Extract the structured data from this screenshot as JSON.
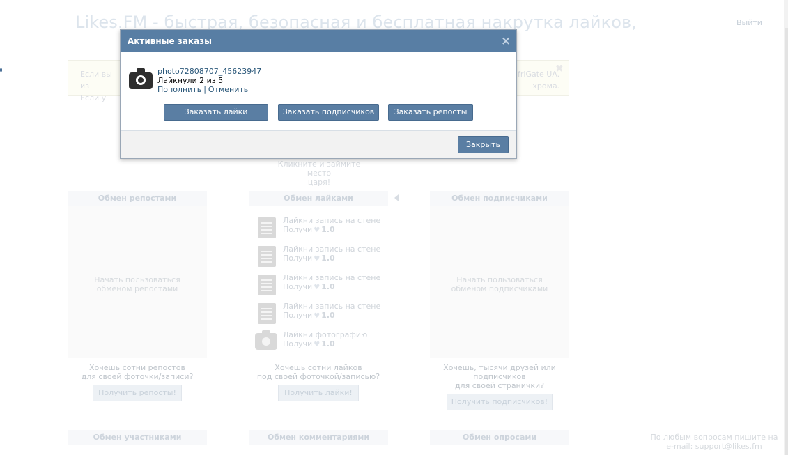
{
  "page": {
    "site_title": "Likes.FM - быстрая, безопасная и бесплатная накрутка лайков,",
    "logout": "Выйти",
    "info_left": "Если вы из\nЕсли у",
    "info_right": "friGate UA.\nхрома.",
    "info_close": "✖",
    "king_text": "Кликните и займите место\nцаря!",
    "footer_note": "По любым вопросам пишите на\ne-mail: support@likes.fm"
  },
  "columns": [
    {
      "title": "Обмен репостами",
      "empty": "Начать пользоваться\nобменом репостами",
      "promo": "Хочешь сотни репостов\nдля своей фоточки/записи?",
      "button": "Получить репосты!"
    },
    {
      "title": "Обмен лайками",
      "promo": "Хочешь сотни лайков\nпод своей фоточкой/записью?",
      "button": "Получить лайки!"
    },
    {
      "title": "Обмен подписчиками",
      "empty": "Начать пользоваться\nобменом подписчиками",
      "promo": "Хочешь, тысячи друзей или\nподписчиков\nдля своей странички?",
      "button": "Получить подписчиков!"
    }
  ],
  "tasks": [
    {
      "icon": "document-icon",
      "label": "Лайкни запись на стене",
      "reward_label": "Получи",
      "reward": "1.0"
    },
    {
      "icon": "document-icon",
      "label": "Лайкни запись на стене",
      "reward_label": "Получи",
      "reward": "1.0"
    },
    {
      "icon": "document-icon",
      "label": "Лайкни запись на стене",
      "reward_label": "Получи",
      "reward": "1.0"
    },
    {
      "icon": "document-icon",
      "label": "Лайкни запись на стене",
      "reward_label": "Получи",
      "reward": "1.0"
    },
    {
      "icon": "camera-icon",
      "label": "Лайкни фотографию",
      "reward_label": "Получи",
      "reward": "1.0"
    }
  ],
  "bottom_sections": [
    "Обмен участниками",
    "Обмен комментариями",
    "Обмен опросами"
  ],
  "modal": {
    "title": "Активные заказы",
    "close_icon": "×",
    "order": {
      "icon": "camera-icon",
      "name": "photo72808707_45623947",
      "status": "Лайкнули 2 из 5",
      "topup": "Пополнить",
      "separator": "|",
      "cancel": "Отменить"
    },
    "buttons": {
      "order_likes": "Заказать лайки",
      "order_subscribers": "Заказать подписчиков",
      "order_reposts": "Заказать репосты",
      "close": "Закрыть"
    }
  },
  "colors": {
    "modal_header": "#587ea4",
    "button": "#5a7ea3",
    "link": "#2b587a"
  }
}
